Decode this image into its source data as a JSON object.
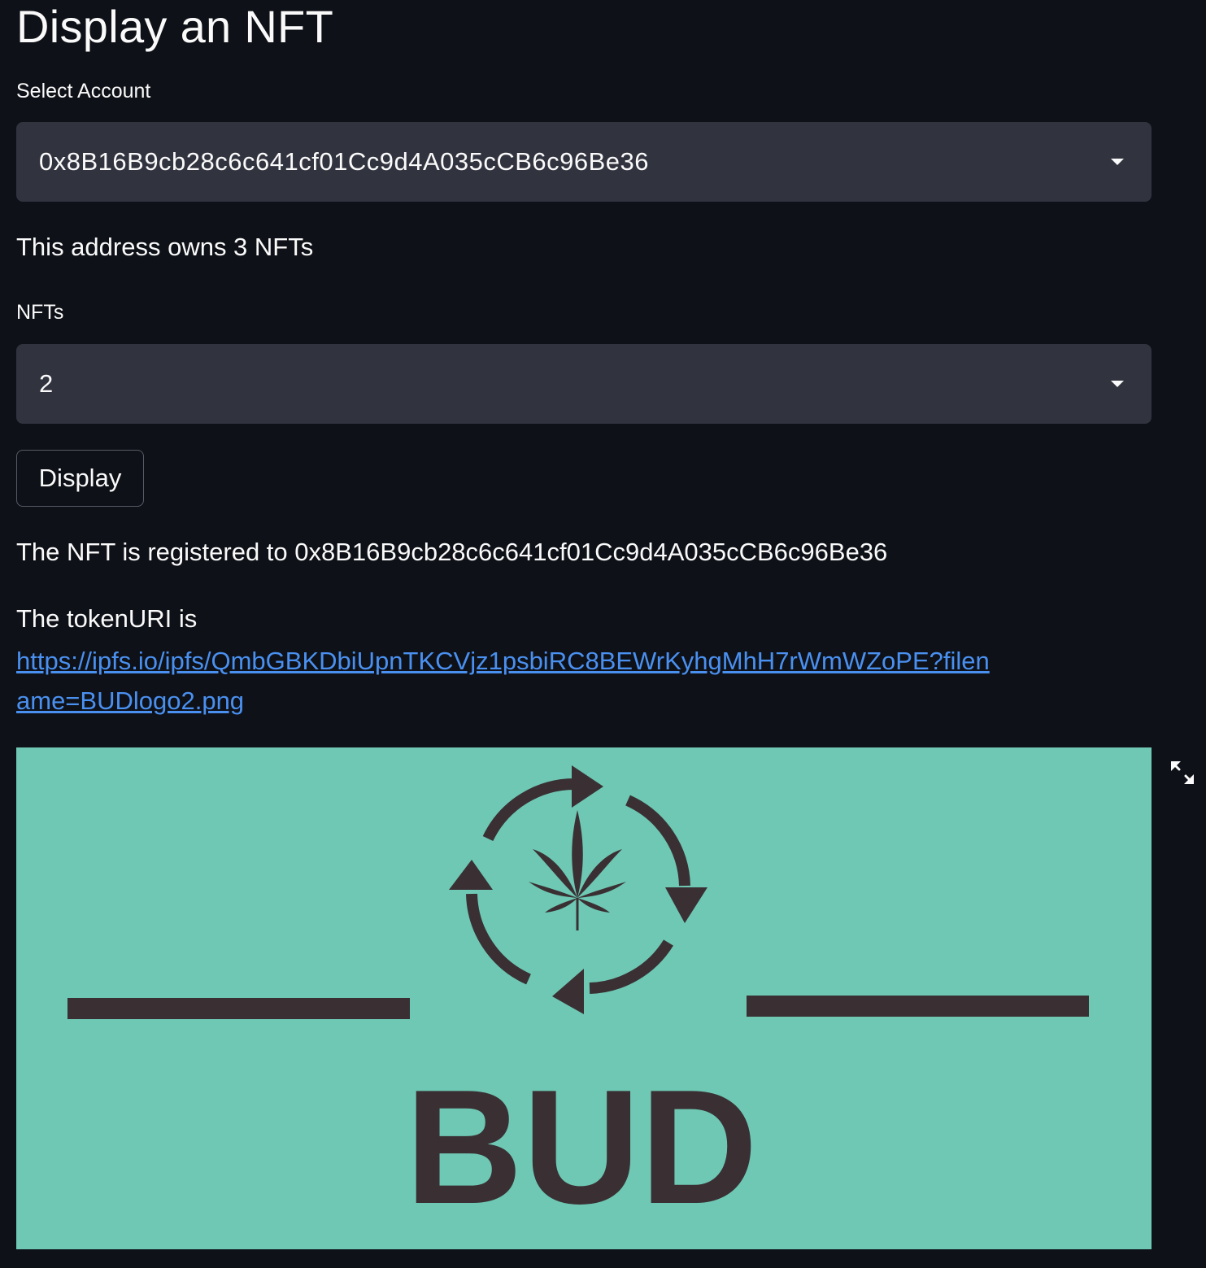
{
  "page": {
    "title": "Display an NFT"
  },
  "account_select": {
    "label": "Select Account",
    "value": "0x8B16B9cb28c6c641cf01Cc9d4A035cCB6c96Be36"
  },
  "owns_text": "This address owns 3 NFTs",
  "nft_select": {
    "label": "NFTs",
    "value": "2"
  },
  "display_button": {
    "label": "Display"
  },
  "registered_text": "The NFT is registered to 0x8B16B9cb28c6c641cf01Cc9d4A035cCB6c96Be36",
  "token_uri": {
    "label": "The tokenURI is",
    "url": "https://ipfs.io/ipfs/QmbGBKDbiUpnTKCVjz1psbiRC8BEWrKyhgMhH7rWmWZoPE?filename=BUDlogo2.png"
  },
  "nft_image": {
    "logo_text": "BUD",
    "background_color": "#6ec8b4",
    "ink_color": "#3a3033"
  },
  "icons": {
    "dropdown": "chevron-down-icon",
    "fullscreen": "fullscreen-icon"
  }
}
